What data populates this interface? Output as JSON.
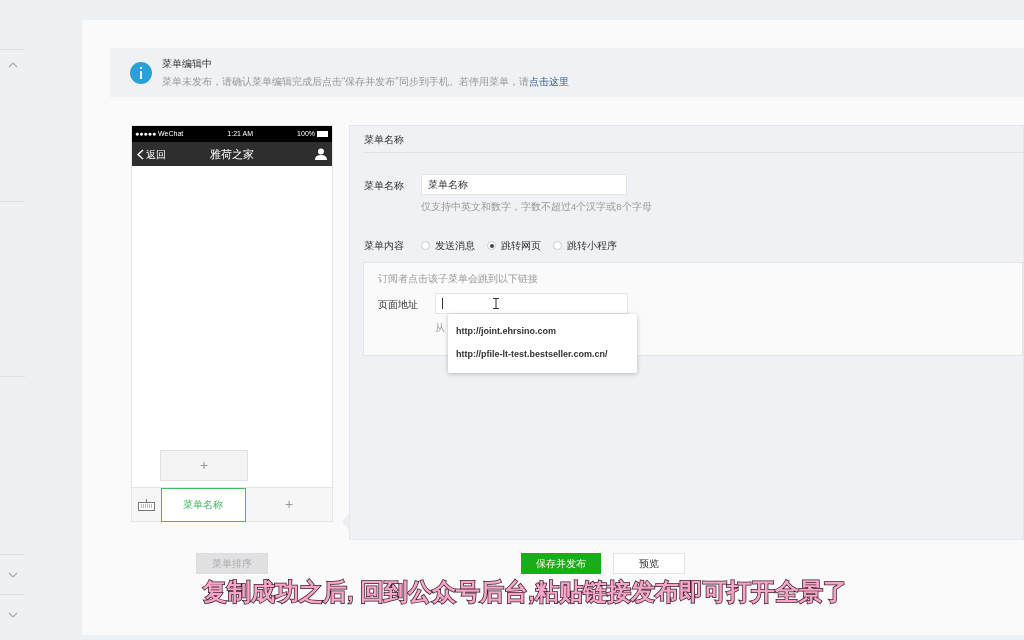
{
  "notice": {
    "title": "菜单编辑中",
    "message": "菜单未发布，请确认菜单编辑完成后点击“保存并发布”同步到手机。若停用菜单，请",
    "link": "点击这里"
  },
  "phone": {
    "status_bar": {
      "carrier": "●●●●● WeChat",
      "time": "1:21 AM",
      "battery": "100%"
    },
    "back": "返回",
    "title": "雅荷之家",
    "submenu_add": "+",
    "menus": [
      {
        "label": "菜单名称",
        "selected": true
      },
      {
        "label": "+",
        "selected": false
      }
    ]
  },
  "editor": {
    "header": "菜单名称",
    "name_label": "菜单名称",
    "name_value": "菜单名称",
    "name_hint": "仅支持中英文和数字，字数不超过4个汉字或8个字母",
    "content_label": "菜单内容",
    "options": [
      {
        "label": "发送消息",
        "selected": false
      },
      {
        "label": "跳转网页",
        "selected": true
      },
      {
        "label": "跳转小程序",
        "selected": false
      }
    ],
    "link_hint": "订阅者点击该子菜单会跳到以下链接",
    "url_label": "页面地址",
    "url_note": "从",
    "suggestions": [
      "http://joint.ehrsino.com",
      "http://pfile-lt-test.bestseller.com.cn/"
    ]
  },
  "buttons": [
    {
      "label": "菜单排序",
      "kind": "disabled"
    },
    {
      "label": "保存并发布",
      "kind": "primary"
    },
    {
      "label": "预览",
      "kind": "default"
    }
  ],
  "subtitle": "复制成功之后, 回到公众号后台,粘贴链接发布即可打开全景了"
}
